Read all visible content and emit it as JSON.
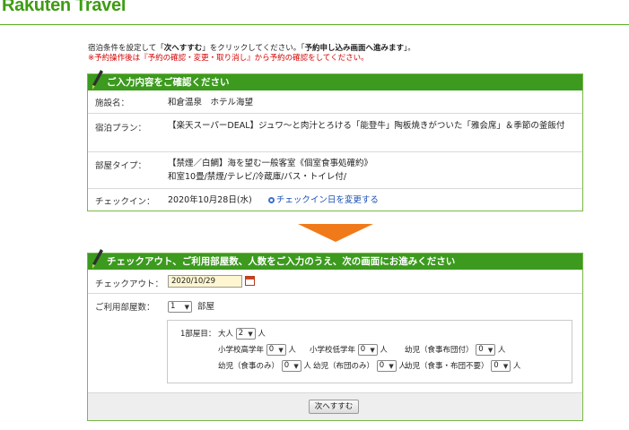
{
  "header": {
    "logo": "Rakuten Travel"
  },
  "intro": {
    "line1_a": "宿泊条件を設定して「",
    "line1_b": "次へすすむ",
    "line1_c": "」をクリックしてください。「",
    "line1_d": "予約申し込み画面へ進みます",
    "line1_e": "」。",
    "line2": "※予約操作後は『予約の確認・変更・取り消し』から予約の確認をしてください。"
  },
  "confirm": {
    "heading": "ご入力内容をご確認ください",
    "facility_label": "施設名：",
    "facility_value": "和倉温泉　ホテル海望",
    "plan_label": "宿泊プラン：",
    "plan_value": "【楽天スーパーDEAL】ジュワ～と肉汁とろける「能登牛」陶板焼きがついた「雅会席」＆季節の釜飯付",
    "room_label": "部屋タイプ：",
    "room_value_1": "【禁煙／白鯛】海を望む一般客室《個室食事処確約》",
    "room_value_2": "和室10畳/禁煙/テレビ/冷蔵庫/バス・トイレ付/",
    "checkin_label": "チェックイン：",
    "checkin_value": "2020年10月28日(水)",
    "checkin_change_link": "チェックイン日を変更する"
  },
  "form": {
    "heading": "チェックアウト、ご利用部屋数、人数をご入力のうえ、次の画面にお進みください",
    "checkout_label": "チェックアウト：",
    "checkout_value": "2020/10/29",
    "rooms_label": "ご利用部屋数：",
    "rooms_value": "1",
    "rooms_unit": "部屋",
    "room_index_label": "1部屋目：",
    "adult_label": "大人",
    "adult_value": "2",
    "person_unit": "人",
    "upper_elem_label": "小学校高学年",
    "upper_elem_value": "0",
    "lower_elem_label": "小学校低学年",
    "lower_elem_value": "0",
    "infant_meal_bed_label": "幼児（食事布団付）",
    "infant_meal_bed_value": "0",
    "infant_meal_label": "幼児（食事のみ）",
    "infant_meal_value": "0",
    "infant_bed_label": "幼児（布団のみ）",
    "infant_bed_value": "0",
    "infant_none_label": "幼児（食事・布団不要）",
    "infant_none_value": "0",
    "next_button": "次へすすむ"
  },
  "colors": {
    "brand_green": "#3c9a1e",
    "arrow_orange": "#f07a1a",
    "link_blue": "#1a4fb5",
    "notice_red": "#d40000"
  }
}
